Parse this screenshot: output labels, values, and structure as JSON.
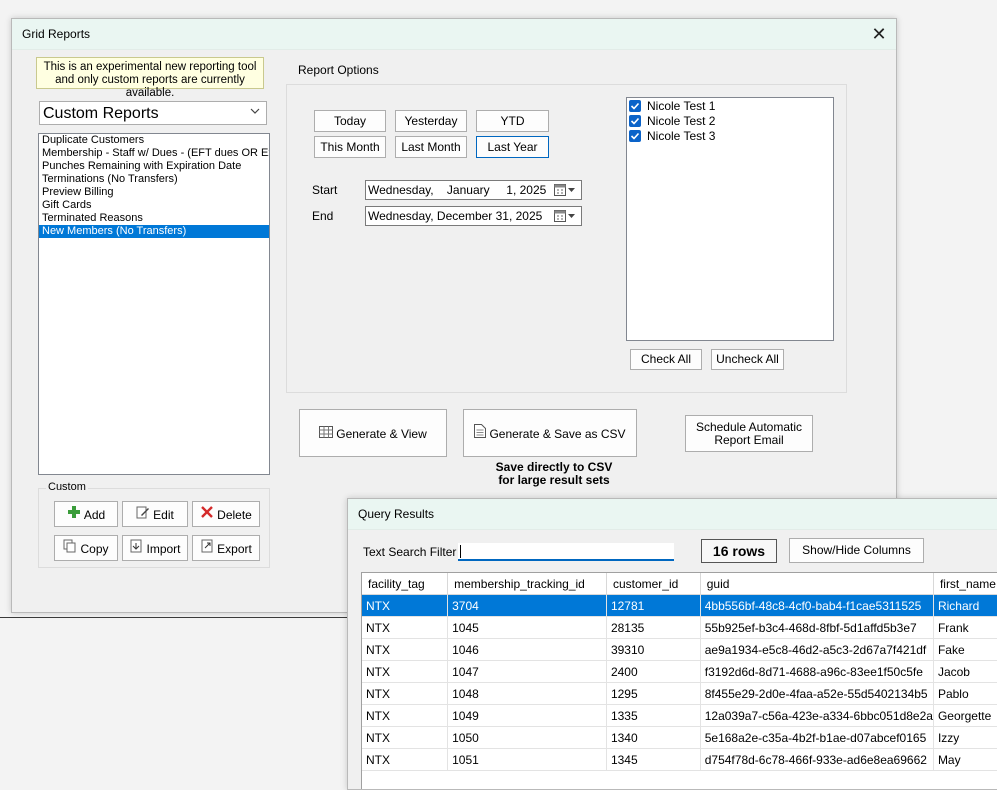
{
  "main_window": {
    "title": "Grid Reports",
    "close_glyph": "✕",
    "notice": "This is an experimental new reporting tool and only custom reports are currently available.",
    "report_type": "Custom Reports",
    "reports": [
      "Duplicate Customers",
      "Membership - Staff w/ Dues - (EFT dues OR Ext",
      "Punches Remaining with Expiration Date",
      "Terminations (No Transfers)",
      "Preview Billing",
      "Gift Cards",
      "Terminated Reasons",
      "New Members (No Transfers)"
    ],
    "selected_report_index": 7,
    "custom_group": {
      "label": "Custom",
      "add": "Add",
      "edit": "Edit",
      "delete": "Delete",
      "copy": "Copy",
      "import": "Import",
      "export": "Export"
    },
    "report_options": {
      "label": "Report Options",
      "presets": {
        "today": "Today",
        "yesterday": "Yesterday",
        "ytd": "YTD",
        "this_month": "This Month",
        "last_month": "Last Month",
        "last_year": "Last Year"
      },
      "selected_preset": "Last Year",
      "start_label": "Start",
      "start_value": "Wednesday,    January     1, 2025",
      "end_label": "End",
      "end_value": "Wednesday, December 31, 2025",
      "facilities": [
        {
          "name": "Nicole Test 1",
          "checked": true
        },
        {
          "name": "Nicole Test 2",
          "checked": true
        },
        {
          "name": "Nicole Test 3",
          "checked": true
        }
      ],
      "check_all": "Check All",
      "uncheck_all": "Uncheck All"
    },
    "actions": {
      "generate_view": "Generate & View",
      "generate_csv": "Generate & Save as CSV",
      "csv_note_line1": "Save directly to CSV",
      "csv_note_line2": "for large result sets",
      "schedule_line1": "Schedule Automatic",
      "schedule_line2": "Report Email"
    }
  },
  "query_window": {
    "title": "Query Results",
    "search_label": "Text Search Filter",
    "search_value": "",
    "rows_count": "16 rows",
    "show_hide": "Show/Hide Columns",
    "columns": [
      "facility_tag",
      "membership_tracking_id",
      "customer_id",
      "guid",
      "first_name"
    ],
    "rows": [
      [
        "NTX",
        "3704",
        "12781",
        "4bb556bf-48c8-4cf0-bab4-f1cae5311525",
        "Richard"
      ],
      [
        "NTX",
        "1045",
        "28135",
        "55b925ef-b3c4-468d-8fbf-5d1affd5b3e7",
        "Frank"
      ],
      [
        "NTX",
        "1046",
        "39310",
        "ae9a1934-e5c8-46d2-a5c3-2d67a7f421df",
        "Fake"
      ],
      [
        "NTX",
        "1047",
        "2400",
        "f3192d6d-8d71-4688-a96c-83ee1f50c5fe",
        "Jacob"
      ],
      [
        "NTX",
        "1048",
        "1295",
        "8f455e29-2d0e-4faa-a52e-55d5402134b5",
        "Pablo"
      ],
      [
        "NTX",
        "1049",
        "1335",
        "12a039a7-c56a-423e-a334-6bbc051d8e2a",
        "Georgette"
      ],
      [
        "NTX",
        "1050",
        "1340",
        "5e168a2e-c35a-4b2f-b1ae-d07abcef0165",
        "Izzy"
      ],
      [
        "NTX",
        "1051",
        "1345",
        "d754f78d-6c78-466f-933e-ad6e8ea69662",
        "May"
      ]
    ],
    "selected_row_index": 0
  },
  "colors": {
    "selection": "#0078d7",
    "titlebar": "#eaf6f2",
    "notice_bg": "#ffffe1",
    "checkbox": "#0b63c9"
  }
}
